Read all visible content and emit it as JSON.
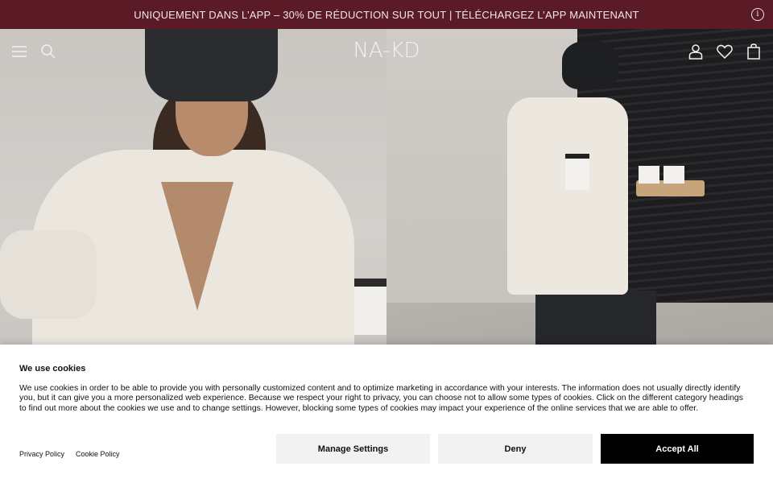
{
  "promo": {
    "text": "UNIQUEMENT DANS L’APP – 30% DE RÉDUCTION SUR TOUT | TÉLÉCHARGEZ L’APP MAINTENANT",
    "info_icon": "info-icon",
    "background": "#5a1a26"
  },
  "header": {
    "logo": "NA-KD",
    "icons": [
      "menu-icon",
      "search-icon",
      "account-icon",
      "wishlist-icon",
      "bag-icon"
    ]
  },
  "cookie": {
    "title": "We use cookies",
    "body": "We use cookies in order to be able to provide you with personally customized content and to optimize marketing in accordance with your interests. The information does not usually directly identify you, but it can give you a more personalized web experience. Because we respect your right to privacy, you can choose not to allow some types of cookies. Click on the different category headings to find out more about the cookies we use and to change settings. However, blocking some types of cookies may impact your experience of the online services that we are able to offer.",
    "privacy_link": "Privacy Policy",
    "cookie_link": "Cookie Policy",
    "manage_label": "Manage Settings",
    "deny_label": "Deny",
    "accept_label": "Accept All"
  }
}
